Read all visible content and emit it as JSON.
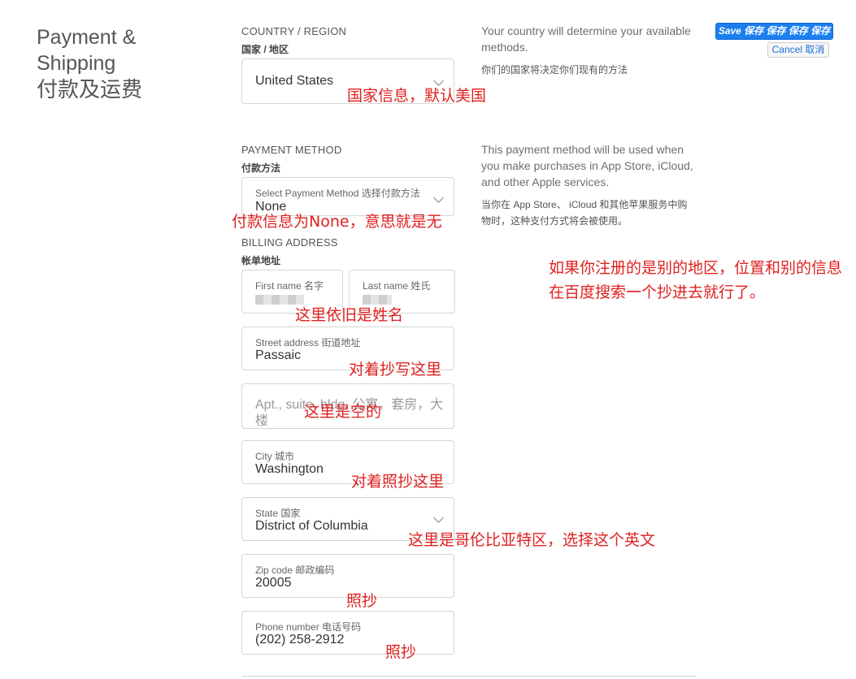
{
  "page": {
    "title_en": "Payment & Shipping",
    "title_zh": "付款及运费"
  },
  "country": {
    "heading_en": "COUNTRY / REGION",
    "heading_zh": "国家 / 地区",
    "value": "United States",
    "note_en": "Your country will determine your available methods.",
    "note_zh": "你们的国家将决定你们现有的方法"
  },
  "payment": {
    "heading_en": "PAYMENT METHOD",
    "heading_zh": "付款方法",
    "label": "Select Payment Method 选择付款方法",
    "value": "None",
    "note_en": "This payment method will be used when you make purchases in App Store, iCloud, and other Apple services.",
    "note_zh": "当你在 App Store、 iCloud 和其他苹果服务中购物时，这种支付方式将会被使用。"
  },
  "billing": {
    "heading_en": "BILLING ADDRESS",
    "heading_zh": "帐单地址",
    "first_name_label": "First name 名字",
    "last_name_label": "Last name 姓氏",
    "street_label": "Street address 街道地址",
    "street_value": "Passaic",
    "apt_placeholder": "Apt., suite, bldg. 公寓，套房，大楼",
    "city_label": "City 城市",
    "city_value": "Washington",
    "state_label": "State 国家",
    "state_value": "District of Columbia",
    "zip_label": "Zip code 邮政编码",
    "zip_value": "20005",
    "phone_label": "Phone number 电话号码",
    "phone_value": "(202) 258-2912"
  },
  "toolbar": {
    "save_label": "Save 保存 保存 保存 保存",
    "cancel_label": "Cancel 取消"
  },
  "annotations": {
    "country": "国家信息，默认美国",
    "payment": "付款信息为None，意思就是无",
    "region_tip": "如果你注册的是别的地区，位置和别的信息在百度搜索一个抄进去就行了。",
    "name": "这里依旧是姓名",
    "street": "对着抄写这里",
    "apt": "这里是空的",
    "city": "对着照抄这里",
    "state": "这里是哥伦比亚特区，选择这个英文",
    "zip": "照抄",
    "phone": "照抄"
  },
  "colors": {
    "accent": "#1b7ff0",
    "annotation": "#e02020"
  }
}
